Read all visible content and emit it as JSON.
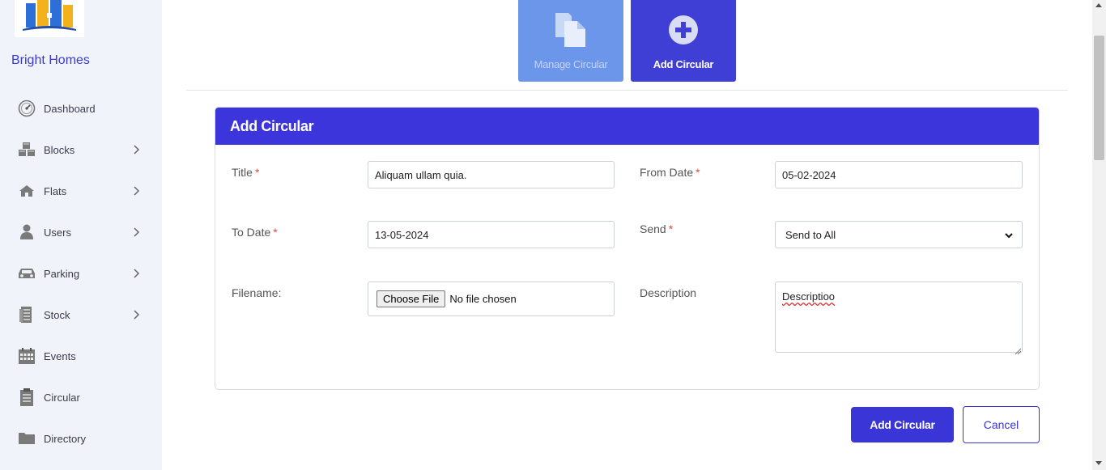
{
  "app": {
    "brand": "Bright Homes"
  },
  "sidebar": {
    "items": [
      {
        "label": "Dashboard",
        "icon": "gauge-icon",
        "has_submenu": false
      },
      {
        "label": "Blocks",
        "icon": "cubes-icon",
        "has_submenu": true
      },
      {
        "label": "Flats",
        "icon": "home-icon",
        "has_submenu": true
      },
      {
        "label": "Users",
        "icon": "user-icon",
        "has_submenu": true
      },
      {
        "label": "Parking",
        "icon": "car-icon",
        "has_submenu": true
      },
      {
        "label": "Stock",
        "icon": "receipt-icon",
        "has_submenu": true
      },
      {
        "label": "Events",
        "icon": "calendar-icon",
        "has_submenu": false
      },
      {
        "label": "Circular",
        "icon": "clipboard-icon",
        "has_submenu": false
      },
      {
        "label": "Directory",
        "icon": "folder-icon",
        "has_submenu": false
      }
    ]
  },
  "tiles": {
    "manage": {
      "label": "Manage Circular",
      "icon": "copy-icon"
    },
    "add": {
      "label": "Add Circular",
      "icon": "plus-circle-icon"
    }
  },
  "form": {
    "header": "Add Circular",
    "title": {
      "label": "Title",
      "value": "Aliquam ullam quia."
    },
    "from_date": {
      "label": "From Date",
      "value": "05-02-2024"
    },
    "to_date": {
      "label": "To Date",
      "value": "13-05-2024"
    },
    "send": {
      "label": "Send",
      "value": "Send to All"
    },
    "filename": {
      "label": "Filename:",
      "button": "Choose File",
      "status": "No file chosen"
    },
    "description": {
      "label": "Description",
      "value": "Descriptioo"
    },
    "required_mark": "*"
  },
  "actions": {
    "submit": "Add Circular",
    "cancel": "Cancel"
  },
  "colors": {
    "primary": "#3b35db",
    "tile_inactive": "#6b96ea",
    "sidebar_bg": "#f1f3fb",
    "required": "#e04848"
  }
}
